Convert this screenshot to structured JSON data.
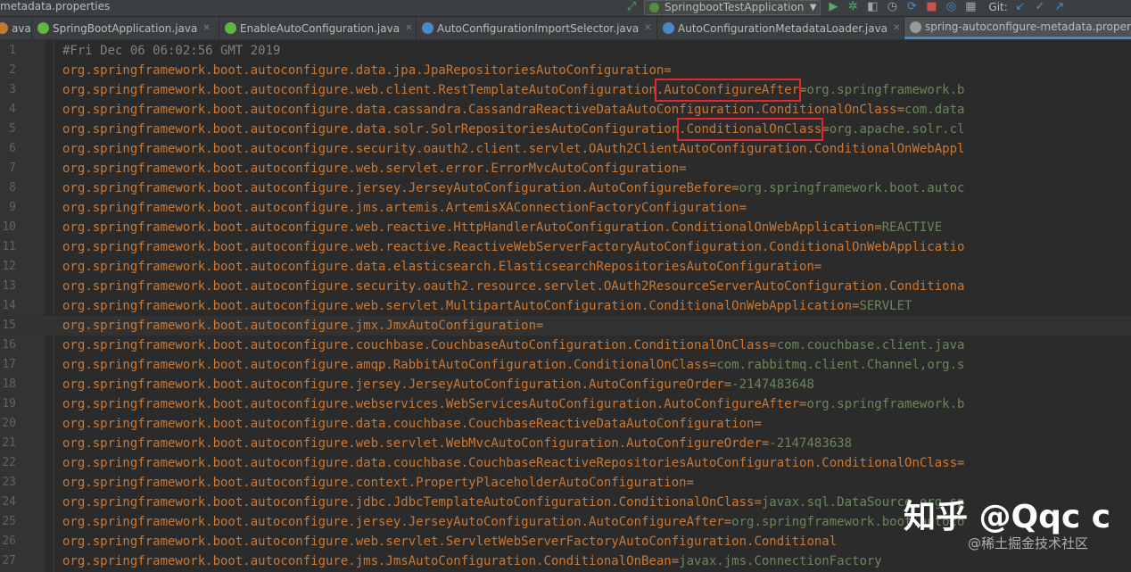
{
  "breadcrumb": "metadata.properties",
  "run_config": "SpringbootTestApplication",
  "vcs_label": "Git:",
  "tabs": [
    {
      "label": "ava",
      "icon": "java-file-icon",
      "color": "#c07b2f",
      "active": false
    },
    {
      "label": "SpringBootApplication.java",
      "icon": "annotation-file-icon",
      "color": "#62b543",
      "active": false
    },
    {
      "label": "EnableAutoConfiguration.java",
      "icon": "annotation-file-icon",
      "color": "#62b543",
      "active": false
    },
    {
      "label": "AutoConfigurationImportSelector.java",
      "icon": "class-file-icon",
      "color": "#4a88c7",
      "active": false
    },
    {
      "label": "AutoConfigurationMetadataLoader.java",
      "icon": "class-file-icon",
      "color": "#4a88c7",
      "active": false
    },
    {
      "label": "spring-autoconfigure-metadata.properties",
      "icon": "properties-file-icon",
      "color": "#999999",
      "active": true
    }
  ],
  "lines": [
    {
      "n": "1",
      "text": "#Fri Dec 06 06:02:56 GMT 2019",
      "comment": true
    },
    {
      "n": "2",
      "key": "org.springframework.boot.autoconfigure.data.jpa.JpaRepositoriesAutoConfiguration=",
      "val": ""
    },
    {
      "n": "3",
      "key": "org.springframework.boot.autoconfigure.web.client.RestTemplateAutoConfiguration.AutoConfigureAfter=",
      "val": "org.springframework.b"
    },
    {
      "n": "4",
      "key": "org.springframework.boot.autoconfigure.data.cassandra.CassandraReactiveDataAutoConfiguration.ConditionalOnClass=",
      "val": "com.data"
    },
    {
      "n": "5",
      "key": "org.springframework.boot.autoconfigure.data.solr.SolrRepositoriesAutoConfiguration.ConditionalOnClass=",
      "val": "org.apache.solr.cl"
    },
    {
      "n": "6",
      "key": "org.springframework.boot.autoconfigure.security.oauth2.client.servlet.OAuth2ClientAutoConfiguration.ConditionalOnWebAppl",
      "val": ""
    },
    {
      "n": "7",
      "key": "org.springframework.boot.autoconfigure.web.servlet.error.ErrorMvcAutoConfiguration=",
      "val": ""
    },
    {
      "n": "8",
      "key": "org.springframework.boot.autoconfigure.jersey.JerseyAutoConfiguration.AutoConfigureBefore=",
      "val": "org.springframework.boot.autoc"
    },
    {
      "n": "9",
      "key": "org.springframework.boot.autoconfigure.jms.artemis.ArtemisXAConnectionFactoryConfiguration=",
      "val": ""
    },
    {
      "n": "10",
      "key": "org.springframework.boot.autoconfigure.web.reactive.HttpHandlerAutoConfiguration.ConditionalOnWebApplication=",
      "val": "REACTIVE"
    },
    {
      "n": "11",
      "key": "org.springframework.boot.autoconfigure.web.reactive.ReactiveWebServerFactoryAutoConfiguration.ConditionalOnWebApplicatio",
      "val": ""
    },
    {
      "n": "12",
      "key": "org.springframework.boot.autoconfigure.data.elasticsearch.ElasticsearchRepositoriesAutoConfiguration=",
      "val": ""
    },
    {
      "n": "13",
      "key": "org.springframework.boot.autoconfigure.security.oauth2.resource.servlet.OAuth2ResourceServerAutoConfiguration.Conditiona",
      "val": ""
    },
    {
      "n": "14",
      "key": "org.springframework.boot.autoconfigure.web.servlet.MultipartAutoConfiguration.ConditionalOnWebApplication=",
      "val": "SERVLET"
    },
    {
      "n": "15",
      "key": "org.springframework.boot.autoconfigure.jmx.JmxAutoConfiguration=",
      "val": "",
      "current": true
    },
    {
      "n": "16",
      "key": "org.springframework.boot.autoconfigure.couchbase.CouchbaseAutoConfiguration.ConditionalOnClass=",
      "val": "com.couchbase.client.java"
    },
    {
      "n": "17",
      "key": "org.springframework.boot.autoconfigure.amqp.RabbitAutoConfiguration.ConditionalOnClass=",
      "val": "com.rabbitmq.client.Channel,org.s"
    },
    {
      "n": "18",
      "key": "org.springframework.boot.autoconfigure.jersey.JerseyAutoConfiguration.AutoConfigureOrder=",
      "val": "-2147483648"
    },
    {
      "n": "19",
      "key": "org.springframework.boot.autoconfigure.webservices.WebServicesAutoConfiguration.AutoConfigureAfter=",
      "val": "org.springframework.b"
    },
    {
      "n": "20",
      "key": "org.springframework.boot.autoconfigure.data.couchbase.CouchbaseReactiveDataAutoConfiguration=",
      "val": ""
    },
    {
      "n": "21",
      "key": "org.springframework.boot.autoconfigure.web.servlet.WebMvcAutoConfiguration.AutoConfigureOrder=",
      "val": "-2147483638"
    },
    {
      "n": "22",
      "key": "org.springframework.boot.autoconfigure.data.couchbase.CouchbaseReactiveRepositoriesAutoConfiguration.ConditionalOnClass=",
      "val": ""
    },
    {
      "n": "23",
      "key": "org.springframework.boot.autoconfigure.context.PropertyPlaceholderAutoConfiguration=",
      "val": ""
    },
    {
      "n": "24",
      "key": "org.springframework.boot.autoconfigure.jdbc.JdbcTemplateAutoConfiguration.ConditionalOnClass=",
      "val": "javax.sql.DataSource,org.sp"
    },
    {
      "n": "25",
      "key": "org.springframework.boot.autoconfigure.jersey.JerseyAutoConfiguration.AutoConfigureAfter=",
      "val": "org.springframework.boot.autoco"
    },
    {
      "n": "26",
      "key": "org.springframework.boot.autoconfigure.web.servlet.ServletWebServerFactoryAutoConfiguration.Conditional",
      "val": ""
    },
    {
      "n": "27",
      "key": "org.springframework.boot.autoconfigure.jms.JmsAutoConfiguration.ConditionalOnBean=",
      "val": "javax.jms.ConnectionFactory"
    }
  ],
  "highlights": [
    {
      "line": "3",
      "text": "AutoConfigureAfter"
    },
    {
      "line": "5",
      "text": "ConditionalOnClass"
    }
  ],
  "watermark": {
    "main": "知乎 @Qqc c",
    "sub": "@稀土掘金技术社区"
  },
  "colors": {
    "key": "#cc7832",
    "value": "#6a8759",
    "comment": "#808080",
    "highlight_box": "#e8252a",
    "active_tab_underline": "#4a88c7"
  }
}
